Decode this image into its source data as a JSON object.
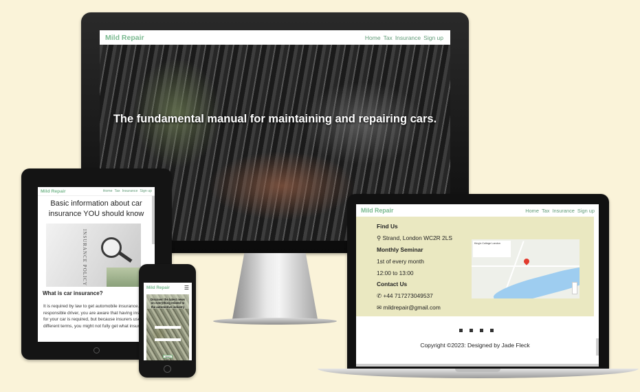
{
  "desktop": {
    "brand": "Mild Repair",
    "nav": [
      "Home",
      "Tax",
      "Insurance",
      "Sign up"
    ],
    "hero_title": "The fundamental manual for maintaining and repairing cars."
  },
  "tablet": {
    "brand": "Mild Repair",
    "nav": [
      "Home",
      "Tax",
      "Insurance",
      "Sign up"
    ],
    "heading": "Basic information about car insurance YOU should know",
    "image_text": "INSURANCE POLICY",
    "subheading": "What is car insurance?",
    "paragraph": "It is required by law to get automobile insurance. As a responsible driver, you are aware that having insurance for your car is required, but because insurers use different terms, you might not fully get what insurance"
  },
  "phone": {
    "brand": "Mild Repair",
    "menu_icon": "hamburger-icon",
    "card_text": "Discover the latest news on everything related to the automotive industry",
    "signup_label": "SIGN UP"
  },
  "laptop": {
    "brand": "Mild Repair",
    "nav": [
      "Home",
      "Tax",
      "Insurance",
      "Sign up"
    ],
    "find_us": "Find Us",
    "address": "Strand, London WC2R 2LS",
    "seminar_heading": "Monthly Seminar",
    "seminar_day": "1st of every month",
    "seminar_time": "12:00 to 13:00",
    "contact_heading": "Contact Us",
    "phone": "+44 717273049537",
    "email": "mildrepair@gmail.com",
    "map_place": "King's College London",
    "copyright": "Copyright ©2023: Designed by Jade Fleck"
  },
  "colors": {
    "background": "#faf3d9",
    "brand": "#79b98f",
    "panel": "#eae8c1"
  }
}
